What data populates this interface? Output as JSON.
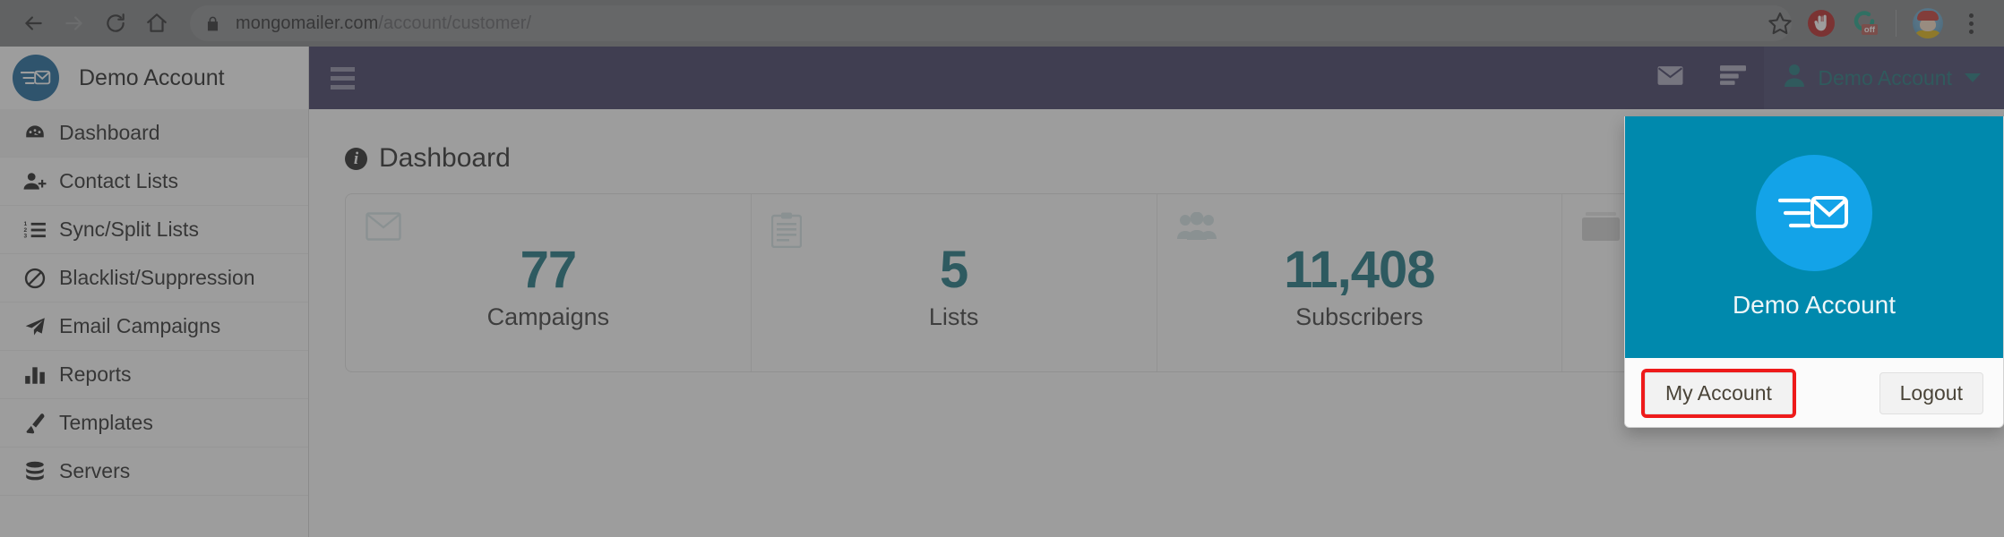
{
  "browser": {
    "back_icon": "arrow-left-icon",
    "forward_icon": "arrow-right-icon",
    "reload_icon": "reload-icon",
    "home_icon": "home-icon",
    "lock_icon": "lock-icon",
    "url_domain": "mongomailer.com",
    "url_path": "/account/customer/",
    "url_full": "mongomailer.com/account/customer/",
    "bookmark_icon": "star-icon",
    "extensions": [
      {
        "name": "adblock-extension-icon",
        "label": "AdBlock"
      },
      {
        "name": "toggle-extension-icon",
        "label": "off"
      },
      {
        "name": "profile-avatar",
        "label": "Profile"
      }
    ],
    "menu_icon": "three-dot-menu-icon"
  },
  "sidebar": {
    "brand": {
      "logo_icon": "mongomailer-logo-icon",
      "name": "Demo Account"
    },
    "items": [
      {
        "label": "Dashboard",
        "icon": "dashboard-icon",
        "active": true
      },
      {
        "label": "Contact Lists",
        "icon": "user-plus-icon",
        "active": false
      },
      {
        "label": "Sync/Split Lists",
        "icon": "ordered-list-icon",
        "active": false
      },
      {
        "label": "Blacklist/Suppression",
        "icon": "ban-icon",
        "active": false
      },
      {
        "label": "Email Campaigns",
        "icon": "paper-plane-icon",
        "active": false
      },
      {
        "label": "Reports",
        "icon": "bar-chart-icon",
        "active": false
      },
      {
        "label": "Templates",
        "icon": "paint-brush-icon",
        "active": false
      },
      {
        "label": "Servers",
        "icon": "database-icon",
        "active": false
      }
    ]
  },
  "navbar": {
    "toggle_icon": "hamburger-menu-icon",
    "mail_icon": "envelope-icon",
    "tasks_icon": "tasks-icon",
    "user_icon": "user-icon",
    "user_label": "Demo Account",
    "caret_icon": "chevron-down-icon"
  },
  "page": {
    "title": "Dashboard",
    "title_icon": "info-circle-icon",
    "stats": [
      {
        "icon": "envelope-icon",
        "value": "77",
        "label": "Campaigns"
      },
      {
        "icon": "clipboard-icon",
        "value": "5",
        "label": "Lists"
      },
      {
        "icon": "users-icon",
        "value": "11,408",
        "label": "Subscribers"
      },
      {
        "icon": "card-icon",
        "value": "",
        "label": ""
      }
    ]
  },
  "account_dropdown": {
    "avatar_icon": "mongomailer-logo-icon",
    "name": "Demo Account",
    "my_account_label": "My Account",
    "logout_label": "Logout",
    "highlight_color": "#ee1b1b"
  },
  "colors": {
    "navbar": "#312e57",
    "teal": "#0089ad",
    "stat_value": "#0b6b78",
    "brand_blue": "#0d5d96",
    "highlight": "#ee1b1b"
  }
}
